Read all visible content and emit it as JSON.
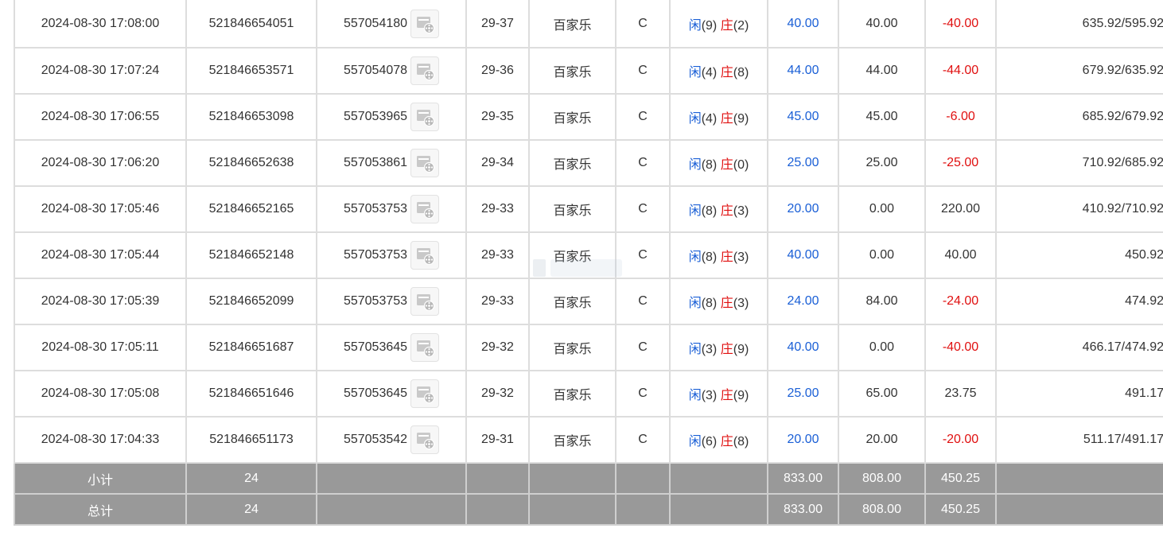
{
  "rows": [
    {
      "time": "2024-08-30 17:08:00",
      "bet_no": "521846654051",
      "game_no": "557054180",
      "round": "29-37",
      "game": "百家乐",
      "table": "C",
      "player_label": "闲",
      "player_score": "(9)",
      "banker_label": "庄",
      "banker_score": "(2)",
      "bet": "40.00",
      "valid": "40.00",
      "win": "-40.00",
      "win_color": "red",
      "balance": "635.92/595.92"
    },
    {
      "time": "2024-08-30 17:07:24",
      "bet_no": "521846653571",
      "game_no": "557054078",
      "round": "29-36",
      "game": "百家乐",
      "table": "C",
      "player_label": "闲",
      "player_score": "(4)",
      "banker_label": "庄",
      "banker_score": "(8)",
      "bet": "44.00",
      "valid": "44.00",
      "win": "-44.00",
      "win_color": "red",
      "balance": "679.92/635.92"
    },
    {
      "time": "2024-08-30 17:06:55",
      "bet_no": "521846653098",
      "game_no": "557053965",
      "round": "29-35",
      "game": "百家乐",
      "table": "C",
      "player_label": "闲",
      "player_score": "(4)",
      "banker_label": "庄",
      "banker_score": "(9)",
      "bet": "45.00",
      "valid": "45.00",
      "win": "-6.00",
      "win_color": "red",
      "balance": "685.92/679.92"
    },
    {
      "time": "2024-08-30 17:06:20",
      "bet_no": "521846652638",
      "game_no": "557053861",
      "round": "29-34",
      "game": "百家乐",
      "table": "C",
      "player_label": "闲",
      "player_score": "(8)",
      "banker_label": "庄",
      "banker_score": "(0)",
      "bet": "25.00",
      "valid": "25.00",
      "win": "-25.00",
      "win_color": "red",
      "balance": "710.92/685.92"
    },
    {
      "time": "2024-08-30 17:05:46",
      "bet_no": "521846652165",
      "game_no": "557053753",
      "round": "29-33",
      "game": "百家乐",
      "table": "C",
      "player_label": "闲",
      "player_score": "(8)",
      "banker_label": "庄",
      "banker_score": "(3)",
      "bet": "20.00",
      "valid": "0.00",
      "win": "220.00",
      "win_color": "dark",
      "balance": "410.92/710.92"
    },
    {
      "time": "2024-08-30 17:05:44",
      "bet_no": "521846652148",
      "game_no": "557053753",
      "round": "29-33",
      "game": "百家乐",
      "table": "C",
      "player_label": "闲",
      "player_score": "(8)",
      "banker_label": "庄",
      "banker_score": "(3)",
      "bet": "40.00",
      "valid": "0.00",
      "win": "40.00",
      "win_color": "dark",
      "balance": "450.92"
    },
    {
      "time": "2024-08-30 17:05:39",
      "bet_no": "521846652099",
      "game_no": "557053753",
      "round": "29-33",
      "game": "百家乐",
      "table": "C",
      "player_label": "闲",
      "player_score": "(8)",
      "banker_label": "庄",
      "banker_score": "(3)",
      "bet": "24.00",
      "valid": "84.00",
      "win": "-24.00",
      "win_color": "red",
      "balance": "474.92"
    },
    {
      "time": "2024-08-30 17:05:11",
      "bet_no": "521846651687",
      "game_no": "557053645",
      "round": "29-32",
      "game": "百家乐",
      "table": "C",
      "player_label": "闲",
      "player_score": "(3)",
      "banker_label": "庄",
      "banker_score": "(9)",
      "bet": "40.00",
      "valid": "0.00",
      "win": "-40.00",
      "win_color": "red",
      "balance": "466.17/474.92"
    },
    {
      "time": "2024-08-30 17:05:08",
      "bet_no": "521846651646",
      "game_no": "557053645",
      "round": "29-32",
      "game": "百家乐",
      "table": "C",
      "player_label": "闲",
      "player_score": "(3)",
      "banker_label": "庄",
      "banker_score": "(9)",
      "bet": "25.00",
      "valid": "65.00",
      "win": "23.75",
      "win_color": "dark",
      "balance": "491.17"
    },
    {
      "time": "2024-08-30 17:04:33",
      "bet_no": "521846651173",
      "game_no": "557053542",
      "round": "29-31",
      "game": "百家乐",
      "table": "C",
      "player_label": "闲",
      "player_score": "(6)",
      "banker_label": "庄",
      "banker_score": "(8)",
      "bet": "20.00",
      "valid": "20.00",
      "win": "-20.00",
      "win_color": "red",
      "balance": "511.17/491.17"
    }
  ],
  "subtotal": {
    "label": "小计",
    "count": "24",
    "bet": "833.00",
    "valid": "808.00",
    "win": "450.25"
  },
  "total": {
    "label": "总计",
    "count": "24",
    "bet": "833.00",
    "valid": "808.00",
    "win": "450.25"
  },
  "icons": {
    "video_replay": "video-replay-icon"
  },
  "colors": {
    "blue": "#1a5fd6",
    "red": "#e01010",
    "sum_bg": "#999999",
    "border": "#dddddd"
  }
}
